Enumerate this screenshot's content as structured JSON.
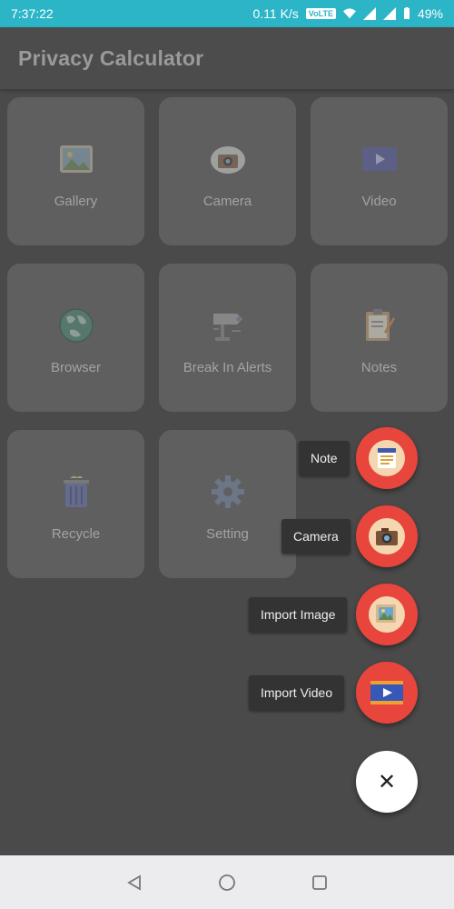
{
  "status_bar": {
    "time": "7:37:22",
    "speed": "0.11 K/s",
    "volte": "VoLTE",
    "battery": "49%"
  },
  "app_bar": {
    "title": "Privacy Calculator"
  },
  "tiles": [
    {
      "label": "Gallery",
      "icon": "gallery-icon"
    },
    {
      "label": "Camera",
      "icon": "camera-icon"
    },
    {
      "label": "Video",
      "icon": "video-icon"
    },
    {
      "label": "Browser",
      "icon": "globe-icon"
    },
    {
      "label": "Break In Alerts",
      "icon": "security-camera-icon"
    },
    {
      "label": "Notes",
      "icon": "clipboard-icon"
    },
    {
      "label": "Recycle",
      "icon": "trash-icon"
    },
    {
      "label": "Setting",
      "icon": "gear-icon"
    }
  ],
  "fab_menu": {
    "items": [
      {
        "label": "Note",
        "icon": "note-icon"
      },
      {
        "label": "Camera",
        "icon": "camera-icon"
      },
      {
        "label": "Import Image",
        "icon": "image-icon"
      },
      {
        "label": "Import Video",
        "icon": "video-icon"
      }
    ],
    "close_glyph": "✕"
  },
  "colors": {
    "status_bar": "#2bb5c7",
    "fab_red": "#e8453c",
    "tile_bg": "#5f5f5f",
    "overlay_bg": "#4a4a4a"
  }
}
